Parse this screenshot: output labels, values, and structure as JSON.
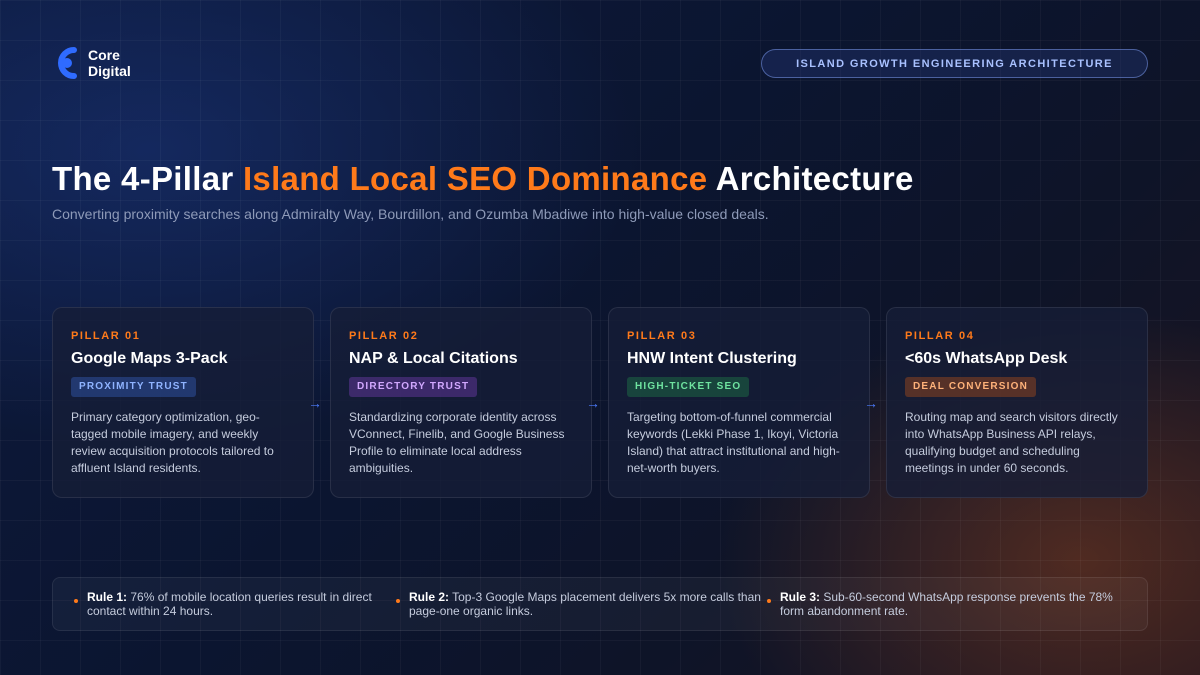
{
  "brand": {
    "logo_line1": "Core",
    "logo_line2": "Digital",
    "accent_color": "#ff7a1a",
    "logo_color": "#2f6bff"
  },
  "header_badge": "ISLAND GROWTH ENGINEERING ARCHITECTURE",
  "title": {
    "prefix": "The 4-Pillar ",
    "accent": "Island Local SEO Dominance",
    "suffix": " Architecture"
  },
  "subtitle": "Converting proximity searches along Admiralty Way, Bourdillon, and Ozumba Mbadiwe into high-value closed deals.",
  "pillars": [
    {
      "number": "PILLAR 01",
      "title": "Google Maps 3-Pack",
      "tag": "PROXIMITY TRUST",
      "description": "Primary category optimization, geo-tagged mobile imagery, and weekly review acquisition protocols tailored to affluent Island residents."
    },
    {
      "number": "PILLAR 02",
      "title": "NAP & Local Citations",
      "tag": "DIRECTORY TRUST",
      "description": "Standardizing corporate identity across VConnect, Finelib, and Google Business Profile to eliminate local address ambiguities."
    },
    {
      "number": "PILLAR 03",
      "title": "HNW Intent Clustering",
      "tag": "HIGH-TICKET SEO",
      "description": "Targeting bottom-of-funnel commercial keywords (Lekki Phase 1, Ikoyi, Victoria Island) that attract institutional and high-net-worth buyers."
    },
    {
      "number": "PILLAR 04",
      "title": "<60s WhatsApp Desk",
      "tag": "DEAL CONVERSION",
      "description": "Routing map and search visitors directly into WhatsApp Business API relays, qualifying budget and scheduling meetings in under 60 seconds."
    }
  ],
  "arrow_glyph": "→",
  "rules": [
    {
      "label": "Rule 1:",
      "text": " 76% of mobile location queries result in direct contact within 24 hours."
    },
    {
      "label": "Rule 2:",
      "text": " Top-3 Google Maps placement delivers 5x more calls than page-one organic links."
    },
    {
      "label": "Rule 3:",
      "text": " Sub-60-second WhatsApp response prevents the 78% form abandonment rate."
    }
  ]
}
